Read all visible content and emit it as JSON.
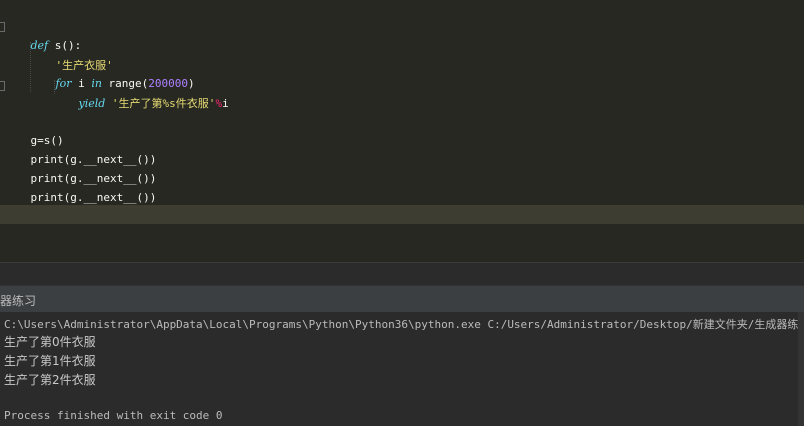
{
  "editor": {
    "lines": {
      "l1": {
        "kw": "def",
        "rest": " s():"
      },
      "l2": {
        "str": "'生产衣服'"
      },
      "l3": {
        "kw1": "for",
        "mid": " i ",
        "kw2": "in",
        "fn": " range(",
        "num": "200000",
        "close": ")"
      },
      "l4": {
        "kw": "yield",
        "str": " '生产了第%s件衣服'",
        "op": "%",
        "var": "i"
      },
      "l6": {
        "text": "g=s()"
      },
      "l7": {
        "text": "print(g.__next__())"
      },
      "l8": {
        "text": "print(g.__next__())"
      },
      "l9": {
        "text": "print(g.__next__())"
      }
    }
  },
  "run": {
    "title": "器练习"
  },
  "console": {
    "command": "C:\\Users\\Administrator\\AppData\\Local\\Programs\\Python\\Python36\\python.exe C:/Users/Administrator/Desktop/新建文件夹/生成器练习.py",
    "out1": "生产了第0件衣服",
    "out2": "生产了第1件衣服",
    "out3": "生产了第2件衣服",
    "exit": "Process finished with exit code 0"
  },
  "colors": {
    "editor_bg": "#272822",
    "keyword": "#66d9ef",
    "string": "#e6db74",
    "number": "#ae81ff",
    "console_bg": "#2b2b2b"
  }
}
